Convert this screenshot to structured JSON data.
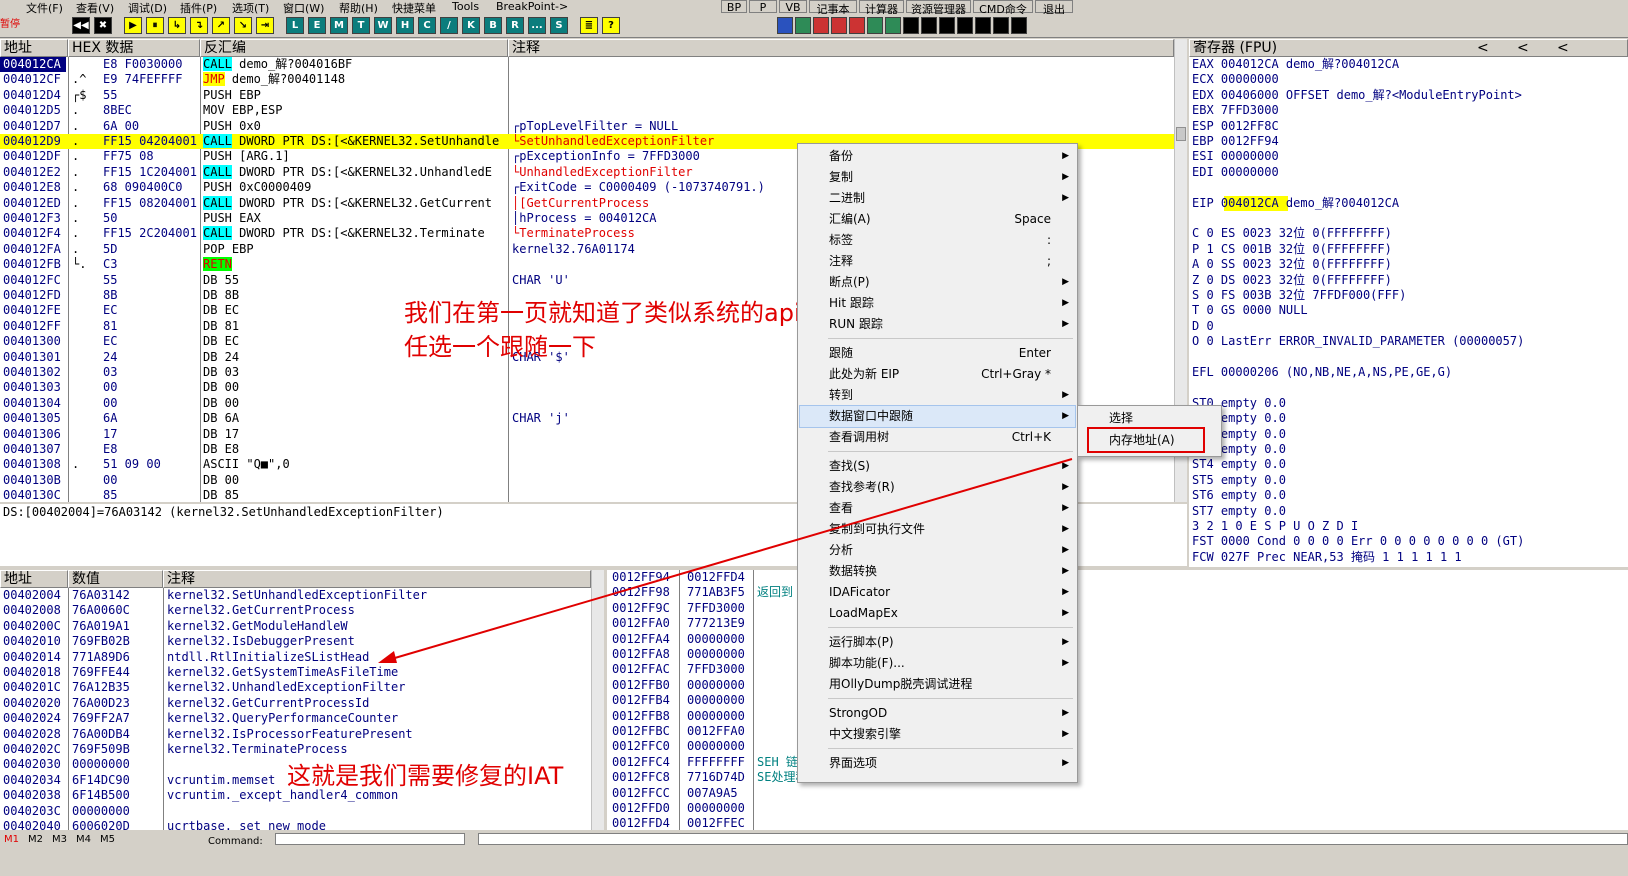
{
  "menubar": {
    "items": [
      "文件(F)",
      "查看(V)",
      "调试(D)",
      "插件(P)",
      "选项(T)",
      "窗口(W)",
      "帮助(H)",
      "快捷菜单",
      "Tools",
      "BreakPoint->"
    ],
    "right_buttons": [
      "BP",
      "P",
      "VB",
      "记事本",
      "计算器",
      "资源管理器",
      "CMD命令",
      "退出"
    ]
  },
  "toolbar": {
    "status": "暂停",
    "buttons": [
      "◀◀",
      "✖",
      "▶",
      "⏸",
      "↳",
      "↴",
      "↗",
      "↘",
      "⇥",
      "L",
      "E",
      "M",
      "T",
      "W",
      "H",
      "C",
      "/",
      "K",
      "B",
      "R",
      "...",
      "S",
      "≣",
      "?"
    ]
  },
  "cpu": {
    "headers": {
      "address": "地址",
      "hex": "HEX 数据",
      "disasm": "反汇编",
      "comment": "注释"
    },
    "rows": [
      {
        "addr": "004012CA",
        "mark": "",
        "hex": "E8 F0030000",
        "op": "CALL",
        "rest": " demo_解?004016BF",
        "comment": "",
        "style": "sel"
      },
      {
        "addr": "004012CF",
        "mark": ".^",
        "hex": "E9 74FEFFFF",
        "op": "JMP",
        "rest": " demo_解?00401148",
        "comment": ""
      },
      {
        "addr": "004012D4",
        "mark": "┌$",
        "hex": "55",
        "op": "",
        "rest": "PUSH EBP",
        "comment": ""
      },
      {
        "addr": "004012D5",
        "mark": ".",
        "hex": "8BEC",
        "op": "",
        "rest": "MOV EBP,ESP",
        "comment": ""
      },
      {
        "addr": "004012D7",
        "mark": ".",
        "hex": "6A 00",
        "op": "",
        "rest": "PUSH 0x0",
        "comment": "┌pTopLevelFilter = NULL"
      },
      {
        "addr": "004012D9",
        "mark": ".",
        "hex": "FF15 04204001",
        "op": "CALL",
        "rest": " DWORD PTR DS:[<&KERNEL32.SetUnhandle",
        "comment": "└SetUnhandledExceptionFilter",
        "style": "hl"
      },
      {
        "addr": "004012DF",
        "mark": ".",
        "hex": "FF75 08",
        "op": "",
        "rest": "PUSH [ARG.1]",
        "comment": "┌pExceptionInfo = 7FFD3000"
      },
      {
        "addr": "004012E2",
        "mark": ".",
        "hex": "FF15 1C204001",
        "op": "CALL",
        "rest": " DWORD PTR DS:[<&KERNEL32.UnhandledE",
        "comment": "└UnhandledExceptionFilter"
      },
      {
        "addr": "004012E8",
        "mark": ".",
        "hex": "68 090400C0",
        "op": "",
        "rest": "PUSH 0xC0000409",
        "comment": "┌ExitCode = C0000409 (-1073740791.)"
      },
      {
        "addr": "004012ED",
        "mark": ".",
        "hex": "FF15 08204001",
        "op": "CALL",
        "rest": " DWORD PTR DS:[<&KERNEL32.GetCurrent",
        "comment": "│[GetCurrentProcess"
      },
      {
        "addr": "004012F3",
        "mark": ".",
        "hex": "50",
        "op": "",
        "rest": "PUSH EAX",
        "comment": "│hProcess = 004012CA"
      },
      {
        "addr": "004012F4",
        "mark": ".",
        "hex": "FF15 2C204001",
        "op": "CALL",
        "rest": " DWORD PTR DS:[<&KERNEL32.Terminate",
        "comment": "└TerminateProcess"
      },
      {
        "addr": "004012FA",
        "mark": ".",
        "hex": "5D",
        "op": "",
        "rest": "POP EBP",
        "comment": "kernel32.76A01174"
      },
      {
        "addr": "004012FB",
        "mark": "└.",
        "hex": "C3",
        "op": "RETN",
        "rest": "",
        "comment": ""
      },
      {
        "addr": "004012FC",
        "mark": "",
        "hex": "55",
        "op": "",
        "rest": "DB 55",
        "comment": "CHAR 'U'"
      },
      {
        "addr": "004012FD",
        "mark": "",
        "hex": "8B",
        "op": "",
        "rest": "DB 8B",
        "comment": ""
      },
      {
        "addr": "004012FE",
        "mark": "",
        "hex": "EC",
        "op": "",
        "rest": "DB EC",
        "comment": ""
      },
      {
        "addr": "004012FF",
        "mark": "",
        "hex": "81",
        "op": "",
        "rest": "DB 81",
        "comment": ""
      },
      {
        "addr": "00401300",
        "mark": "",
        "hex": "EC",
        "op": "",
        "rest": "DB EC",
        "comment": ""
      },
      {
        "addr": "00401301",
        "mark": "",
        "hex": "24",
        "op": "",
        "rest": "DB 24",
        "comment": "CHAR '$'"
      },
      {
        "addr": "00401302",
        "mark": "",
        "hex": "03",
        "op": "",
        "rest": "DB 03",
        "comment": ""
      },
      {
        "addr": "00401303",
        "mark": "",
        "hex": "00",
        "op": "",
        "rest": "DB 00",
        "comment": ""
      },
      {
        "addr": "00401304",
        "mark": "",
        "hex": "00",
        "op": "",
        "rest": "DB 00",
        "comment": ""
      },
      {
        "addr": "00401305",
        "mark": "",
        "hex": "6A",
        "op": "",
        "rest": "DB 6A",
        "comment": "CHAR 'j'"
      },
      {
        "addr": "00401306",
        "mark": "",
        "hex": "17",
        "op": "",
        "rest": "DB 17",
        "comment": ""
      },
      {
        "addr": "00401307",
        "mark": "",
        "hex": "E8",
        "op": "",
        "rest": "DB E8",
        "comment": ""
      },
      {
        "addr": "00401308",
        "mark": ".",
        "hex": "51 09 00",
        "op": "",
        "rest": "ASCII \"Q■\",0",
        "comment": ""
      },
      {
        "addr": "0040130B",
        "mark": "",
        "hex": "00",
        "op": "",
        "rest": "DB 00",
        "comment": ""
      },
      {
        "addr": "0040130C",
        "mark": "",
        "hex": "85",
        "op": "",
        "rest": "DB 85",
        "comment": ""
      }
    ]
  },
  "infoline": "DS:[00402004]=76A03142 (kernel32.SetUnhandledExceptionFilter)",
  "registers": {
    "title": "寄存器 (FPU)",
    "nav": [
      "<",
      "<",
      "<"
    ],
    "lines": [
      "EAX 004012CA demo_解?004012CA",
      "ECX 00000000",
      "EDX 00406000 OFFSET demo_解?<ModuleEntryPoint>",
      "EBX 7FFD3000",
      "ESP 0012FF8C",
      "EBP 0012FF94",
      "ESI 00000000",
      "EDI 00000000",
      "",
      "EIP 004012CA demo_解?004012CA",
      "",
      "C 0  ES 0023 32位 0(FFFFFFFF)",
      "P 1  CS 001B 32位 0(FFFFFFFF)",
      "A 0  SS 0023 32位 0(FFFFFFFF)",
      "Z 0  DS 0023 32位 0(FFFFFFFF)",
      "S 0  FS 003B 32位 7FFDF000(FFF)",
      "T 0  GS 0000 NULL",
      "D 0",
      "O 0  LastErr ERROR_INVALID_PARAMETER (00000057)",
      "",
      "EFL 00000206 (NO,NB,NE,A,NS,PE,GE,G)",
      "",
      "ST0 empty 0.0",
      "ST1 empty 0.0",
      "ST2 empty 0.0",
      "ST3 empty 0.0",
      "ST4 empty 0.0",
      "ST5 empty 0.0",
      "ST6 empty 0.0",
      "ST7 empty 0.0",
      "               3 2 1 0      E S P U O Z D I",
      "FST 0000  Cond 0 0 0 0  Err 0 0 0 0 0 0 0 0  (GT)",
      "FCW 027F  Prec NEAR,53  掩码    1 1 1 1 1 1"
    ]
  },
  "dump": {
    "headers": {
      "address": "地址",
      "value": "数值",
      "comment": "注释"
    },
    "rows": [
      [
        "00402004",
        "76A03142",
        "kernel32.SetUnhandledExceptionFilter"
      ],
      [
        "00402008",
        "76A0060C",
        "kernel32.GetCurrentProcess"
      ],
      [
        "0040200C",
        "76A019A1",
        "kernel32.GetModuleHandleW"
      ],
      [
        "00402010",
        "769FB02B",
        "kernel32.IsDebuggerPresent"
      ],
      [
        "00402014",
        "771A89D6",
        "ntdll.RtlInitializeSListHead"
      ],
      [
        "00402018",
        "769FFE44",
        "kernel32.GetSystemTimeAsFileTime"
      ],
      [
        "0040201C",
        "76A12B35",
        "kernel32.UnhandledExceptionFilter"
      ],
      [
        "00402020",
        "76A00D23",
        "kernel32.GetCurrentProcessId"
      ],
      [
        "00402024",
        "769FF2A7",
        "kernel32.QueryPerformanceCounter"
      ],
      [
        "00402028",
        "76A00DB4",
        "kernel32.IsProcessorFeaturePresent"
      ],
      [
        "0040202C",
        "769F509B",
        "kernel32.TerminateProcess"
      ],
      [
        "00402030",
        "00000000",
        ""
      ],
      [
        "00402034",
        "6F14DC90",
        "vcruntim.memset"
      ],
      [
        "00402038",
        "6F14B500",
        "vcruntim._except_handler4_common"
      ],
      [
        "0040203C",
        "00000000",
        ""
      ],
      [
        "00402040",
        "6006020D",
        "ucrtbase._set_new_mode"
      ]
    ]
  },
  "stack": {
    "rows": [
      [
        "0012FF94",
        "0012FFD4",
        ""
      ],
      [
        "0012FF98",
        "771AB3F5",
        "返回到"
      ],
      [
        "0012FF9C",
        "7FFD3000",
        ""
      ],
      [
        "0012FFA0",
        "777213E9",
        ""
      ],
      [
        "0012FFA4",
        "00000000",
        ""
      ],
      [
        "0012FFA8",
        "00000000",
        ""
      ],
      [
        "0012FFAC",
        "7FFD3000",
        ""
      ],
      [
        "0012FFB0",
        "00000000",
        ""
      ],
      [
        "0012FFB4",
        "00000000",
        ""
      ],
      [
        "0012FFB8",
        "00000000",
        ""
      ],
      [
        "0012FFBC",
        "0012FFA0",
        ""
      ],
      [
        "0012FFC0",
        "00000000",
        ""
      ],
      [
        "0012FFC4",
        "FFFFFFFF",
        "SEH 链"
      ],
      [
        "0012FFC8",
        "7716D74D",
        "SE处理程序"
      ],
      [
        "0012FFCC",
        "007A9A5",
        ""
      ],
      [
        "0012FFD0",
        "00000000",
        ""
      ],
      [
        "0012FFD4",
        "0012FFEC",
        ""
      ]
    ]
  },
  "statusbar": {
    "marks": [
      "M1",
      "M2",
      "M3",
      "M4",
      "M5"
    ],
    "command_label": "Command:"
  },
  "context_menu": {
    "items": [
      {
        "label": "备份",
        "shortcut": "",
        "arrow": true
      },
      {
        "label": "复制",
        "shortcut": "",
        "arrow": true
      },
      {
        "label": "二进制",
        "shortcut": "",
        "arrow": true
      },
      {
        "label": "汇编(A)",
        "shortcut": "Space",
        "arrow": false
      },
      {
        "label": "标签",
        "shortcut": ":",
        "arrow": false
      },
      {
        "label": "注释",
        "shortcut": ";",
        "arrow": false
      },
      {
        "label": "断点(P)",
        "shortcut": "",
        "arrow": true
      },
      {
        "label": "Hit 跟踪",
        "shortcut": "",
        "arrow": true
      },
      {
        "label": "RUN 跟踪",
        "shortcut": "",
        "arrow": true
      },
      {
        "sep": true
      },
      {
        "label": "跟随",
        "shortcut": "Enter",
        "arrow": false
      },
      {
        "label": "此处为新 EIP",
        "shortcut": "Ctrl+Gray *",
        "arrow": false
      },
      {
        "label": "转到",
        "shortcut": "",
        "arrow": true
      },
      {
        "label": "数据窗口中跟随",
        "shortcut": "",
        "arrow": true,
        "active": true
      },
      {
        "label": "查看调用树",
        "shortcut": "Ctrl+K",
        "arrow": false
      },
      {
        "sep": true
      },
      {
        "label": "查找(S)",
        "shortcut": "",
        "arrow": true
      },
      {
        "label": "查找参考(R)",
        "shortcut": "",
        "arrow": true
      },
      {
        "label": "查看",
        "shortcut": "",
        "arrow": true
      },
      {
        "label": "复制到可执行文件",
        "shortcut": "",
        "arrow": true
      },
      {
        "label": "分析",
        "shortcut": "",
        "arrow": true
      },
      {
        "label": "数据转换",
        "shortcut": "",
        "arrow": true
      },
      {
        "label": "IDAFicator",
        "shortcut": "",
        "arrow": true
      },
      {
        "label": "LoadMapEx",
        "shortcut": "",
        "arrow": true
      },
      {
        "sep": true
      },
      {
        "label": "运行脚本(P)",
        "shortcut": "",
        "arrow": true
      },
      {
        "label": "脚本功能(F)...",
        "shortcut": "",
        "arrow": true
      },
      {
        "label": "用OllyDump脱壳调试进程",
        "shortcut": "",
        "arrow": false
      },
      {
        "sep": true
      },
      {
        "label": "StrongOD",
        "shortcut": "",
        "arrow": true
      },
      {
        "label": "中文搜索引擎",
        "shortcut": "",
        "arrow": true
      },
      {
        "sep": true
      },
      {
        "label": "界面选项",
        "shortcut": "",
        "arrow": true
      }
    ]
  },
  "submenu": {
    "items": [
      "选择",
      "内存地址(A)"
    ]
  },
  "annotations": {
    "top_line1": "我们在第一页就知道了类似系统的api",
    "top_line2": "任选一个跟随一下",
    "bottom": "这就是我们需要修复的IAT"
  },
  "colors": {
    "annotation": "#e00000",
    "selection": "#000080",
    "highlight": "#ffff00",
    "call": "#00ffff"
  }
}
